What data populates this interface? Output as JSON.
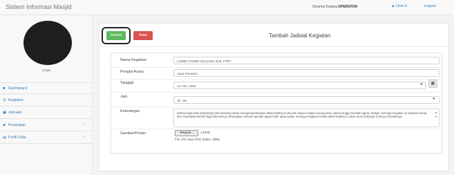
{
  "topbar": {
    "brand": "Sistem Informasi Masjid",
    "welcome_prefix": "Selamat Datang",
    "welcome_role": "OPERATOR",
    "user_menu": "▲ User ▾",
    "logout": "Logout"
  },
  "sidebar": {
    "username": "yoga",
    "items": [
      {
        "label": "Dashboard",
        "icon": "dashboard-icon",
        "glyph": "■"
      },
      {
        "label": "Kegiatan",
        "icon": "list-icon",
        "glyph": "☰"
      },
      {
        "label": "Jemaah",
        "icon": "users-icon",
        "glyph": "▣"
      },
      {
        "label": "Keuangan",
        "icon": "money-icon",
        "glyph": "▰"
      },
      {
        "label": "Profil Data",
        "icon": "document-icon",
        "glyph": "▤"
      }
    ]
  },
  "header": {
    "save_label": "Simpan",
    "cancel_label": "Batal",
    "title": "Tambah Jadwal Kegiatan"
  },
  "form": {
    "nama": {
      "label": "Nama Kegiatan",
      "value": "LOMBA TAKBIR KELILING IDUL FITRI"
    },
    "pengisi": {
      "label": "Pengisi Acara",
      "value": "Agus Purnama"
    },
    "tanggal": {
      "label": "Tanggal",
      "value": "14 / 06 / 2018"
    },
    "jam": {
      "label": "Jam",
      "value": "19 : 00"
    },
    "keterangan": {
      "label": "Keterangan",
      "value": "Selesai isya kami berkumpul dan bersama-sama mengumandangkan takbir keliling mulai dari depan masjid menuju jalan utama hingga kembali lagi ke masjid. Semoga kegiatan ini berjalan lancar dan membawa berkah bagi kita semua. Diharapkan seluruh jamaah dapat hadir tepat waktu. Semoga kegiatan lomba takbir keliling ini akan terus berlanjut di tahun2 berikutnya."
    },
    "gambar": {
      "label": "Gambar/Poster",
      "button": "Telusuri...",
      "filename": "1.PNG",
      "help": "File JPG atau PNG (Maks. 3MB)"
    }
  },
  "colors": {
    "save": "#5cb85c",
    "cancel": "#d9534f",
    "link": "#337ab7"
  }
}
